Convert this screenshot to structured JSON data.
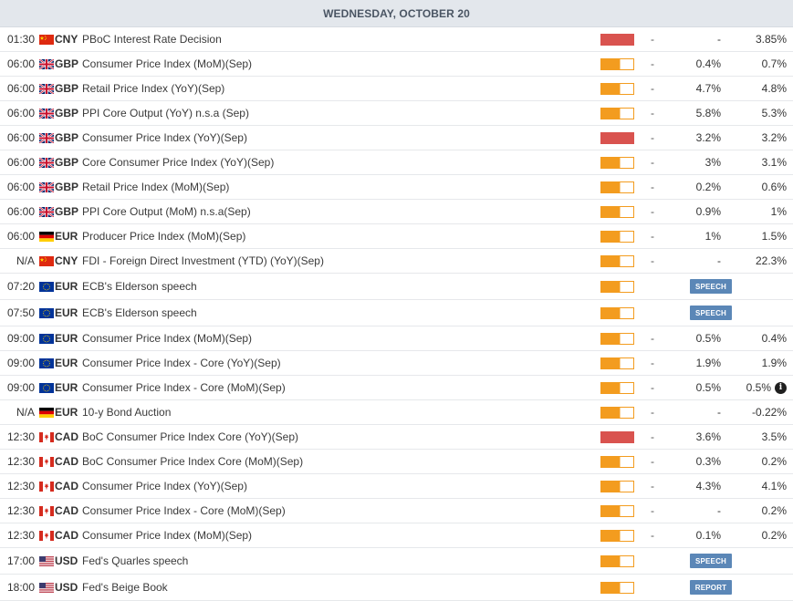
{
  "header": {
    "date_label": "WEDNESDAY, OCTOBER 20"
  },
  "colors": {
    "impact_high": "#d9534f",
    "impact_medium": "#f39c1f",
    "badge": "#5b87b7"
  },
  "events": [
    {
      "time": "01:30",
      "flag": "cn",
      "currency": "CNY",
      "event": "PBoC Interest Rate Decision",
      "impact": "high",
      "actual": "-",
      "consensus": "-",
      "previous": "3.85%"
    },
    {
      "time": "06:00",
      "flag": "gb",
      "currency": "GBP",
      "event": "Consumer Price Index (MoM)(Sep)",
      "impact": "medium",
      "actual": "-",
      "consensus": "0.4%",
      "previous": "0.7%"
    },
    {
      "time": "06:00",
      "flag": "gb",
      "currency": "GBP",
      "event": "Retail Price Index (YoY)(Sep)",
      "impact": "medium",
      "actual": "-",
      "consensus": "4.7%",
      "previous": "4.8%"
    },
    {
      "time": "06:00",
      "flag": "gb",
      "currency": "GBP",
      "event": "PPI Core Output (YoY) n.s.a (Sep)",
      "impact": "medium",
      "actual": "-",
      "consensus": "5.8%",
      "previous": "5.3%"
    },
    {
      "time": "06:00",
      "flag": "gb",
      "currency": "GBP",
      "event": "Consumer Price Index (YoY)(Sep)",
      "impact": "high",
      "actual": "-",
      "consensus": "3.2%",
      "previous": "3.2%"
    },
    {
      "time": "06:00",
      "flag": "gb",
      "currency": "GBP",
      "event": "Core Consumer Price Index (YoY)(Sep)",
      "impact": "medium",
      "actual": "-",
      "consensus": "3%",
      "previous": "3.1%"
    },
    {
      "time": "06:00",
      "flag": "gb",
      "currency": "GBP",
      "event": "Retail Price Index (MoM)(Sep)",
      "impact": "medium",
      "actual": "-",
      "consensus": "0.2%",
      "previous": "0.6%"
    },
    {
      "time": "06:00",
      "flag": "gb",
      "currency": "GBP",
      "event": "PPI Core Output (MoM) n.s.a(Sep)",
      "impact": "medium",
      "actual": "-",
      "consensus": "0.9%",
      "previous": "1%"
    },
    {
      "time": "06:00",
      "flag": "de",
      "currency": "EUR",
      "event": "Producer Price Index (MoM)(Sep)",
      "impact": "medium",
      "actual": "-",
      "consensus": "1%",
      "previous": "1.5%"
    },
    {
      "time": "N/A",
      "flag": "cn",
      "currency": "CNY",
      "event": "FDI - Foreign Direct Investment (YTD) (YoY)(Sep)",
      "impact": "medium",
      "actual": "-",
      "consensus": "-",
      "previous": "22.3%"
    },
    {
      "time": "07:20",
      "flag": "eu",
      "currency": "EUR",
      "event": "ECB's Elderson speech",
      "impact": "medium",
      "badge": "SPEECH",
      "tall": true
    },
    {
      "time": "07:50",
      "flag": "eu",
      "currency": "EUR",
      "event": "ECB's Elderson speech",
      "impact": "medium",
      "badge": "SPEECH",
      "tall": true
    },
    {
      "time": "09:00",
      "flag": "eu",
      "currency": "EUR",
      "event": "Consumer Price Index (MoM)(Sep)",
      "impact": "medium",
      "actual": "-",
      "consensus": "0.5%",
      "previous": "0.4%"
    },
    {
      "time": "09:00",
      "flag": "eu",
      "currency": "EUR",
      "event": "Consumer Price Index - Core (YoY)(Sep)",
      "impact": "medium",
      "actual": "-",
      "consensus": "1.9%",
      "previous": "1.9%"
    },
    {
      "time": "09:00",
      "flag": "eu",
      "currency": "EUR",
      "event": "Consumer Price Index - Core (MoM)(Sep)",
      "impact": "medium",
      "actual": "-",
      "consensus": "0.5%",
      "previous": "0.5%",
      "info": true
    },
    {
      "time": "N/A",
      "flag": "de",
      "currency": "EUR",
      "event": "10-y Bond Auction",
      "impact": "medium",
      "actual": "-",
      "consensus": "-",
      "previous": "-0.22%"
    },
    {
      "time": "12:30",
      "flag": "ca",
      "currency": "CAD",
      "event": "BoC Consumer Price Index Core (YoY)(Sep)",
      "impact": "high",
      "actual": "-",
      "consensus": "3.6%",
      "previous": "3.5%"
    },
    {
      "time": "12:30",
      "flag": "ca",
      "currency": "CAD",
      "event": "BoC Consumer Price Index Core (MoM)(Sep)",
      "impact": "medium",
      "actual": "-",
      "consensus": "0.3%",
      "previous": "0.2%"
    },
    {
      "time": "12:30",
      "flag": "ca",
      "currency": "CAD",
      "event": "Consumer Price Index (YoY)(Sep)",
      "impact": "medium",
      "actual": "-",
      "consensus": "4.3%",
      "previous": "4.1%"
    },
    {
      "time": "12:30",
      "flag": "ca",
      "currency": "CAD",
      "event": "Consumer Price Index - Core (MoM)(Sep)",
      "impact": "medium",
      "actual": "-",
      "consensus": "-",
      "previous": "0.2%"
    },
    {
      "time": "12:30",
      "flag": "ca",
      "currency": "CAD",
      "event": "Consumer Price Index (MoM)(Sep)",
      "impact": "medium",
      "actual": "-",
      "consensus": "0.1%",
      "previous": "0.2%"
    },
    {
      "time": "17:00",
      "flag": "us",
      "currency": "USD",
      "event": "Fed's Quarles speech",
      "impact": "medium",
      "badge": "SPEECH",
      "tall": true
    },
    {
      "time": "18:00",
      "flag": "us",
      "currency": "USD",
      "event": "Fed's Beige Book",
      "impact": "medium",
      "badge": "REPORT",
      "tall": true
    }
  ]
}
